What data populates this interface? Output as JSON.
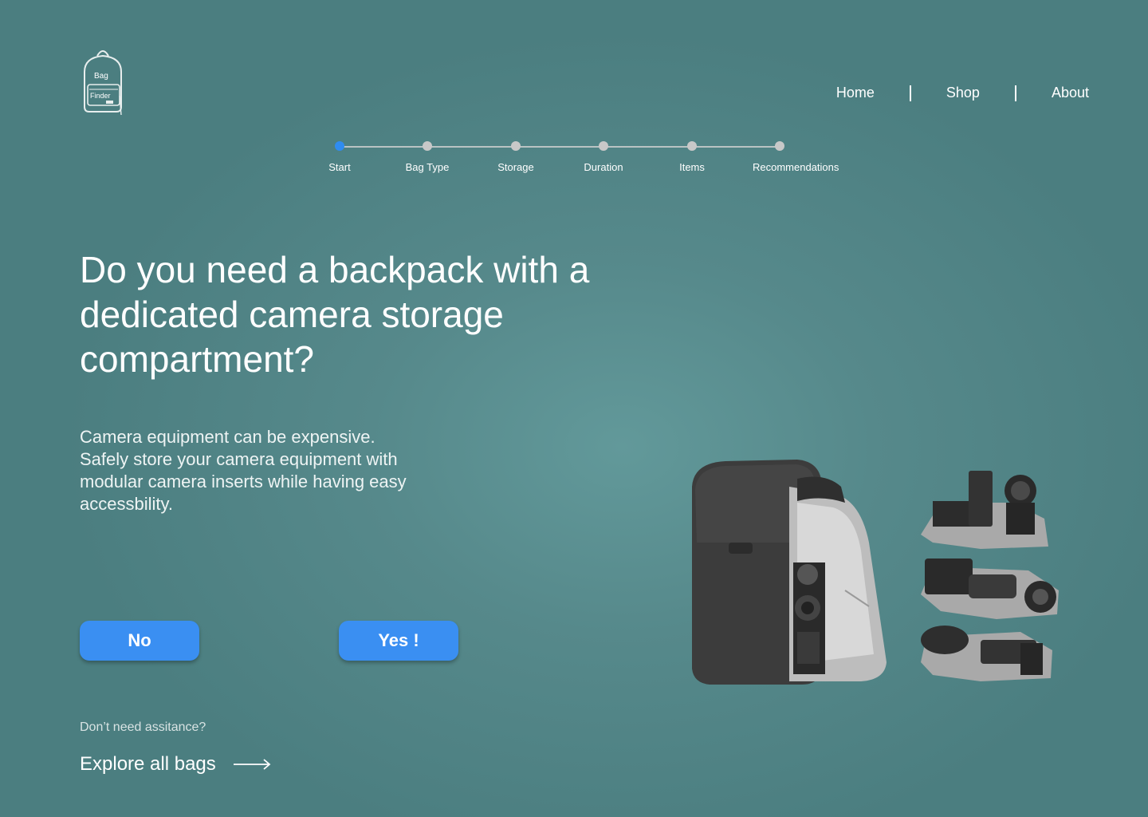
{
  "logo": {
    "line1": "Bag",
    "line2": "Finder"
  },
  "nav": [
    {
      "label": "Home"
    },
    {
      "label": "Shop"
    },
    {
      "label": "About"
    }
  ],
  "stepper": {
    "current_step": 0,
    "steps": [
      {
        "label": "Start"
      },
      {
        "label": "Bag Type"
      },
      {
        "label": "Storage"
      },
      {
        "label": "Duration"
      },
      {
        "label": "Items"
      },
      {
        "label": "Recommendations"
      }
    ]
  },
  "question": {
    "headline": "Do you need a backpack with a dedicated camera storage compartment?",
    "description": "Camera equipment can be expensive. Safely store your camera equipment with modular camera inserts while having easy accessbility."
  },
  "buttons": {
    "no": "No",
    "yes": "Yes !"
  },
  "footer": {
    "assist_text": "Don’t need assitance?",
    "explore_label": "Explore all bags",
    "explore_icon": "arrow-right-icon"
  },
  "colors": {
    "accent": "#3a8ff2",
    "active_step": "#2f8cf0",
    "background": "#56898b"
  }
}
